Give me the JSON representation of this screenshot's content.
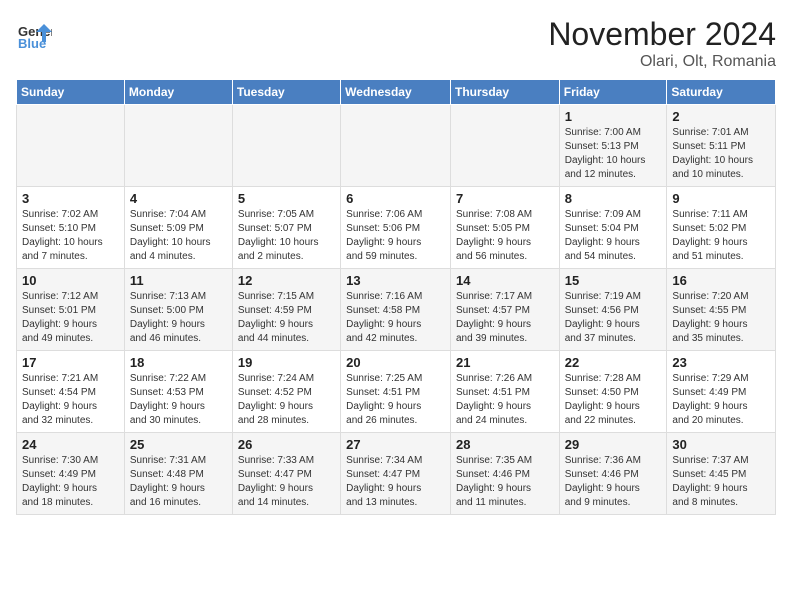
{
  "header": {
    "logo_line1": "General",
    "logo_line2": "Blue",
    "month_title": "November 2024",
    "location": "Olari, Olt, Romania"
  },
  "weekdays": [
    "Sunday",
    "Monday",
    "Tuesday",
    "Wednesday",
    "Thursday",
    "Friday",
    "Saturday"
  ],
  "weeks": [
    [
      {
        "day": "",
        "info": ""
      },
      {
        "day": "",
        "info": ""
      },
      {
        "day": "",
        "info": ""
      },
      {
        "day": "",
        "info": ""
      },
      {
        "day": "",
        "info": ""
      },
      {
        "day": "1",
        "info": "Sunrise: 7:00 AM\nSunset: 5:13 PM\nDaylight: 10 hours\nand 12 minutes."
      },
      {
        "day": "2",
        "info": "Sunrise: 7:01 AM\nSunset: 5:11 PM\nDaylight: 10 hours\nand 10 minutes."
      }
    ],
    [
      {
        "day": "3",
        "info": "Sunrise: 7:02 AM\nSunset: 5:10 PM\nDaylight: 10 hours\nand 7 minutes."
      },
      {
        "day": "4",
        "info": "Sunrise: 7:04 AM\nSunset: 5:09 PM\nDaylight: 10 hours\nand 4 minutes."
      },
      {
        "day": "5",
        "info": "Sunrise: 7:05 AM\nSunset: 5:07 PM\nDaylight: 10 hours\nand 2 minutes."
      },
      {
        "day": "6",
        "info": "Sunrise: 7:06 AM\nSunset: 5:06 PM\nDaylight: 9 hours\nand 59 minutes."
      },
      {
        "day": "7",
        "info": "Sunrise: 7:08 AM\nSunset: 5:05 PM\nDaylight: 9 hours\nand 56 minutes."
      },
      {
        "day": "8",
        "info": "Sunrise: 7:09 AM\nSunset: 5:04 PM\nDaylight: 9 hours\nand 54 minutes."
      },
      {
        "day": "9",
        "info": "Sunrise: 7:11 AM\nSunset: 5:02 PM\nDaylight: 9 hours\nand 51 minutes."
      }
    ],
    [
      {
        "day": "10",
        "info": "Sunrise: 7:12 AM\nSunset: 5:01 PM\nDaylight: 9 hours\nand 49 minutes."
      },
      {
        "day": "11",
        "info": "Sunrise: 7:13 AM\nSunset: 5:00 PM\nDaylight: 9 hours\nand 46 minutes."
      },
      {
        "day": "12",
        "info": "Sunrise: 7:15 AM\nSunset: 4:59 PM\nDaylight: 9 hours\nand 44 minutes."
      },
      {
        "day": "13",
        "info": "Sunrise: 7:16 AM\nSunset: 4:58 PM\nDaylight: 9 hours\nand 42 minutes."
      },
      {
        "day": "14",
        "info": "Sunrise: 7:17 AM\nSunset: 4:57 PM\nDaylight: 9 hours\nand 39 minutes."
      },
      {
        "day": "15",
        "info": "Sunrise: 7:19 AM\nSunset: 4:56 PM\nDaylight: 9 hours\nand 37 minutes."
      },
      {
        "day": "16",
        "info": "Sunrise: 7:20 AM\nSunset: 4:55 PM\nDaylight: 9 hours\nand 35 minutes."
      }
    ],
    [
      {
        "day": "17",
        "info": "Sunrise: 7:21 AM\nSunset: 4:54 PM\nDaylight: 9 hours\nand 32 minutes."
      },
      {
        "day": "18",
        "info": "Sunrise: 7:22 AM\nSunset: 4:53 PM\nDaylight: 9 hours\nand 30 minutes."
      },
      {
        "day": "19",
        "info": "Sunrise: 7:24 AM\nSunset: 4:52 PM\nDaylight: 9 hours\nand 28 minutes."
      },
      {
        "day": "20",
        "info": "Sunrise: 7:25 AM\nSunset: 4:51 PM\nDaylight: 9 hours\nand 26 minutes."
      },
      {
        "day": "21",
        "info": "Sunrise: 7:26 AM\nSunset: 4:51 PM\nDaylight: 9 hours\nand 24 minutes."
      },
      {
        "day": "22",
        "info": "Sunrise: 7:28 AM\nSunset: 4:50 PM\nDaylight: 9 hours\nand 22 minutes."
      },
      {
        "day": "23",
        "info": "Sunrise: 7:29 AM\nSunset: 4:49 PM\nDaylight: 9 hours\nand 20 minutes."
      }
    ],
    [
      {
        "day": "24",
        "info": "Sunrise: 7:30 AM\nSunset: 4:49 PM\nDaylight: 9 hours\nand 18 minutes."
      },
      {
        "day": "25",
        "info": "Sunrise: 7:31 AM\nSunset: 4:48 PM\nDaylight: 9 hours\nand 16 minutes."
      },
      {
        "day": "26",
        "info": "Sunrise: 7:33 AM\nSunset: 4:47 PM\nDaylight: 9 hours\nand 14 minutes."
      },
      {
        "day": "27",
        "info": "Sunrise: 7:34 AM\nSunset: 4:47 PM\nDaylight: 9 hours\nand 13 minutes."
      },
      {
        "day": "28",
        "info": "Sunrise: 7:35 AM\nSunset: 4:46 PM\nDaylight: 9 hours\nand 11 minutes."
      },
      {
        "day": "29",
        "info": "Sunrise: 7:36 AM\nSunset: 4:46 PM\nDaylight: 9 hours\nand 9 minutes."
      },
      {
        "day": "30",
        "info": "Sunrise: 7:37 AM\nSunset: 4:45 PM\nDaylight: 9 hours\nand 8 minutes."
      }
    ]
  ]
}
